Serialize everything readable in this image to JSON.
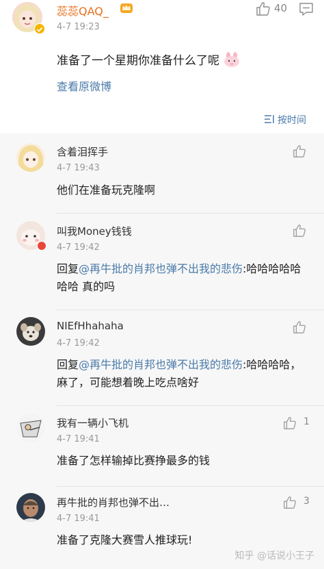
{
  "post": {
    "author_name": "蕊蕊QAQ_",
    "time": "4-7 19:23",
    "like_count": "40",
    "text": "准备了一个星期你准备什么了呢",
    "view_original": "查看原微博",
    "sort_label": "按时间",
    "icons": {
      "crown": "crown-badge-icon",
      "verified": "verified-badge-icon",
      "like": "thumb-up-icon",
      "comment": "comment-icon",
      "bunny": "bunny-emoji-icon",
      "sort": "sort-icon"
    }
  },
  "comments": [
    {
      "name": "含着泪挥手",
      "time": "4-7 19:43",
      "text": "他们在准备玩克隆啊",
      "likes": ""
    },
    {
      "name": "叫我Money钱钱",
      "time": "4-7 19:42",
      "reply_prefix": "回复",
      "mention": "@再牛批的肖邦也弹不出我的悲伤",
      "text_after": ":哈哈哈哈哈哈哈 真的吗",
      "likes": ""
    },
    {
      "name": "NIEfHhahaha",
      "time": "4-7 19:42",
      "reply_prefix": "回复",
      "mention": "@再牛批的肖邦也弹不出我的悲伤",
      "text_after": ":哈哈哈哈，麻了，可能想着晚上吃点啥好",
      "likes": ""
    },
    {
      "name": "我有一辆小飞机",
      "time": "4-7 19:41",
      "text": "准备了怎样输掉比赛挣最多的钱",
      "likes": "1"
    },
    {
      "name": "再牛批的肖邦也弹不出…",
      "time": "4-7 19:41",
      "text": "准备了克隆大赛雪人推球玩!",
      "likes": "3"
    }
  ],
  "watermark": "知乎 @话说小王子",
  "colors": {
    "author_orange": "#e8701e",
    "link_blue": "#4a7aa9",
    "muted_gray": "#999999",
    "comment_bg": "#f7f7f7"
  }
}
